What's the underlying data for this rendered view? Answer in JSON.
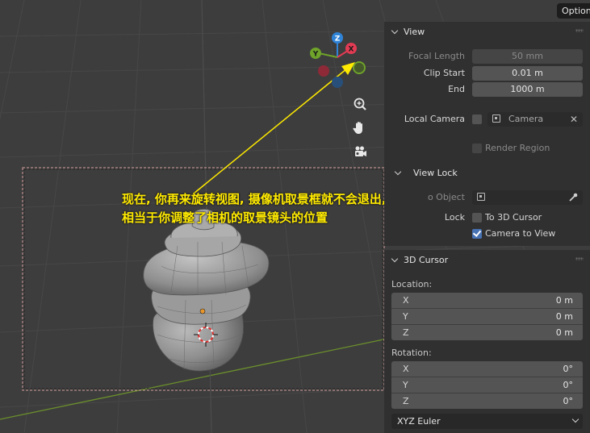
{
  "header": {
    "options_label": "Options"
  },
  "gizmo": {
    "axes": [
      "Z",
      "Y",
      "X"
    ]
  },
  "annotation": {
    "line1": "现在, 你再来旋转视图, 摄像机取景框就不会退出,",
    "line2": "相当于你调整了相机的取景镜头的位置"
  },
  "view_panel": {
    "title": "View",
    "focal_length_label": "Focal Length",
    "focal_length_value": "50 mm",
    "clip_start_label": "Clip Start",
    "clip_start_value": "0.01 m",
    "clip_end_label": "End",
    "clip_end_value": "1000 m",
    "local_camera_label": "Local Camera",
    "local_camera_value": "Camera",
    "render_region_label": "Render Region",
    "render_region_checked": false,
    "view_lock": {
      "title": "View Lock",
      "to_object_label": "o Object",
      "lock_label": "Lock",
      "to_3d_cursor_label": "To 3D Cursor",
      "to_3d_cursor_checked": false,
      "camera_to_view_label": "Camera to View",
      "camera_to_view_checked": true
    }
  },
  "cursor_panel": {
    "title": "3D Cursor",
    "location_label": "Location:",
    "location": [
      {
        "axis": "X",
        "value": "0 m"
      },
      {
        "axis": "Y",
        "value": "0 m"
      },
      {
        "axis": "Z",
        "value": "0 m"
      }
    ],
    "rotation_label": "Rotation:",
    "rotation": [
      {
        "axis": "X",
        "value": "0°"
      },
      {
        "axis": "Y",
        "value": "0°"
      },
      {
        "axis": "Z",
        "value": "0°"
      }
    ],
    "rotation_mode": "XYZ Euler"
  },
  "colors": {
    "viewport_bg": "#3d3d3d",
    "panel_bg": "#303030",
    "annotation": "#ffea00",
    "axis_x": "#e33b53",
    "axis_y": "#6fa32a",
    "axis_z": "#2f84d8",
    "checkbox_on": "#4772b3"
  }
}
